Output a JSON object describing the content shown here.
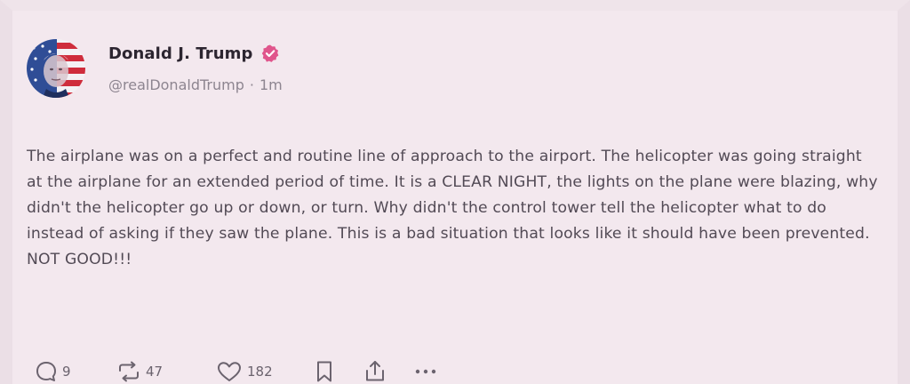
{
  "post": {
    "author": {
      "display_name": "Donald J. Trump",
      "verified": true,
      "handle": "@realDonaldTrump",
      "separator": "·",
      "time": "1m",
      "avatar_icon": "flag-portrait-avatar"
    },
    "text": "The airplane was on a perfect and routine line of approach to the airport. The helicopter was going straight at the airplane for an extended period of time. It is a CLEAR NIGHT, the lights on the plane were blazing, why didn't the helicopter go up or down, or turn. Why didn't the control tower tell the helicopter what to do instead of asking if they saw the plane. This is a bad situation that looks like it should have been prevented. NOT GOOD!!!",
    "actions": {
      "reply": {
        "icon": "reply-icon",
        "count": "9"
      },
      "repost": {
        "icon": "repost-icon",
        "count": "47"
      },
      "like": {
        "icon": "heart-icon",
        "count": "182"
      },
      "bookmark": {
        "icon": "bookmark-icon"
      },
      "share": {
        "icon": "share-icon"
      },
      "more": {
        "icon": "more-icon"
      }
    }
  },
  "colors": {
    "background": "#f3e8ee",
    "verified_badge": "#e0558c",
    "text": "#524a55",
    "muted": "#8d8590"
  }
}
